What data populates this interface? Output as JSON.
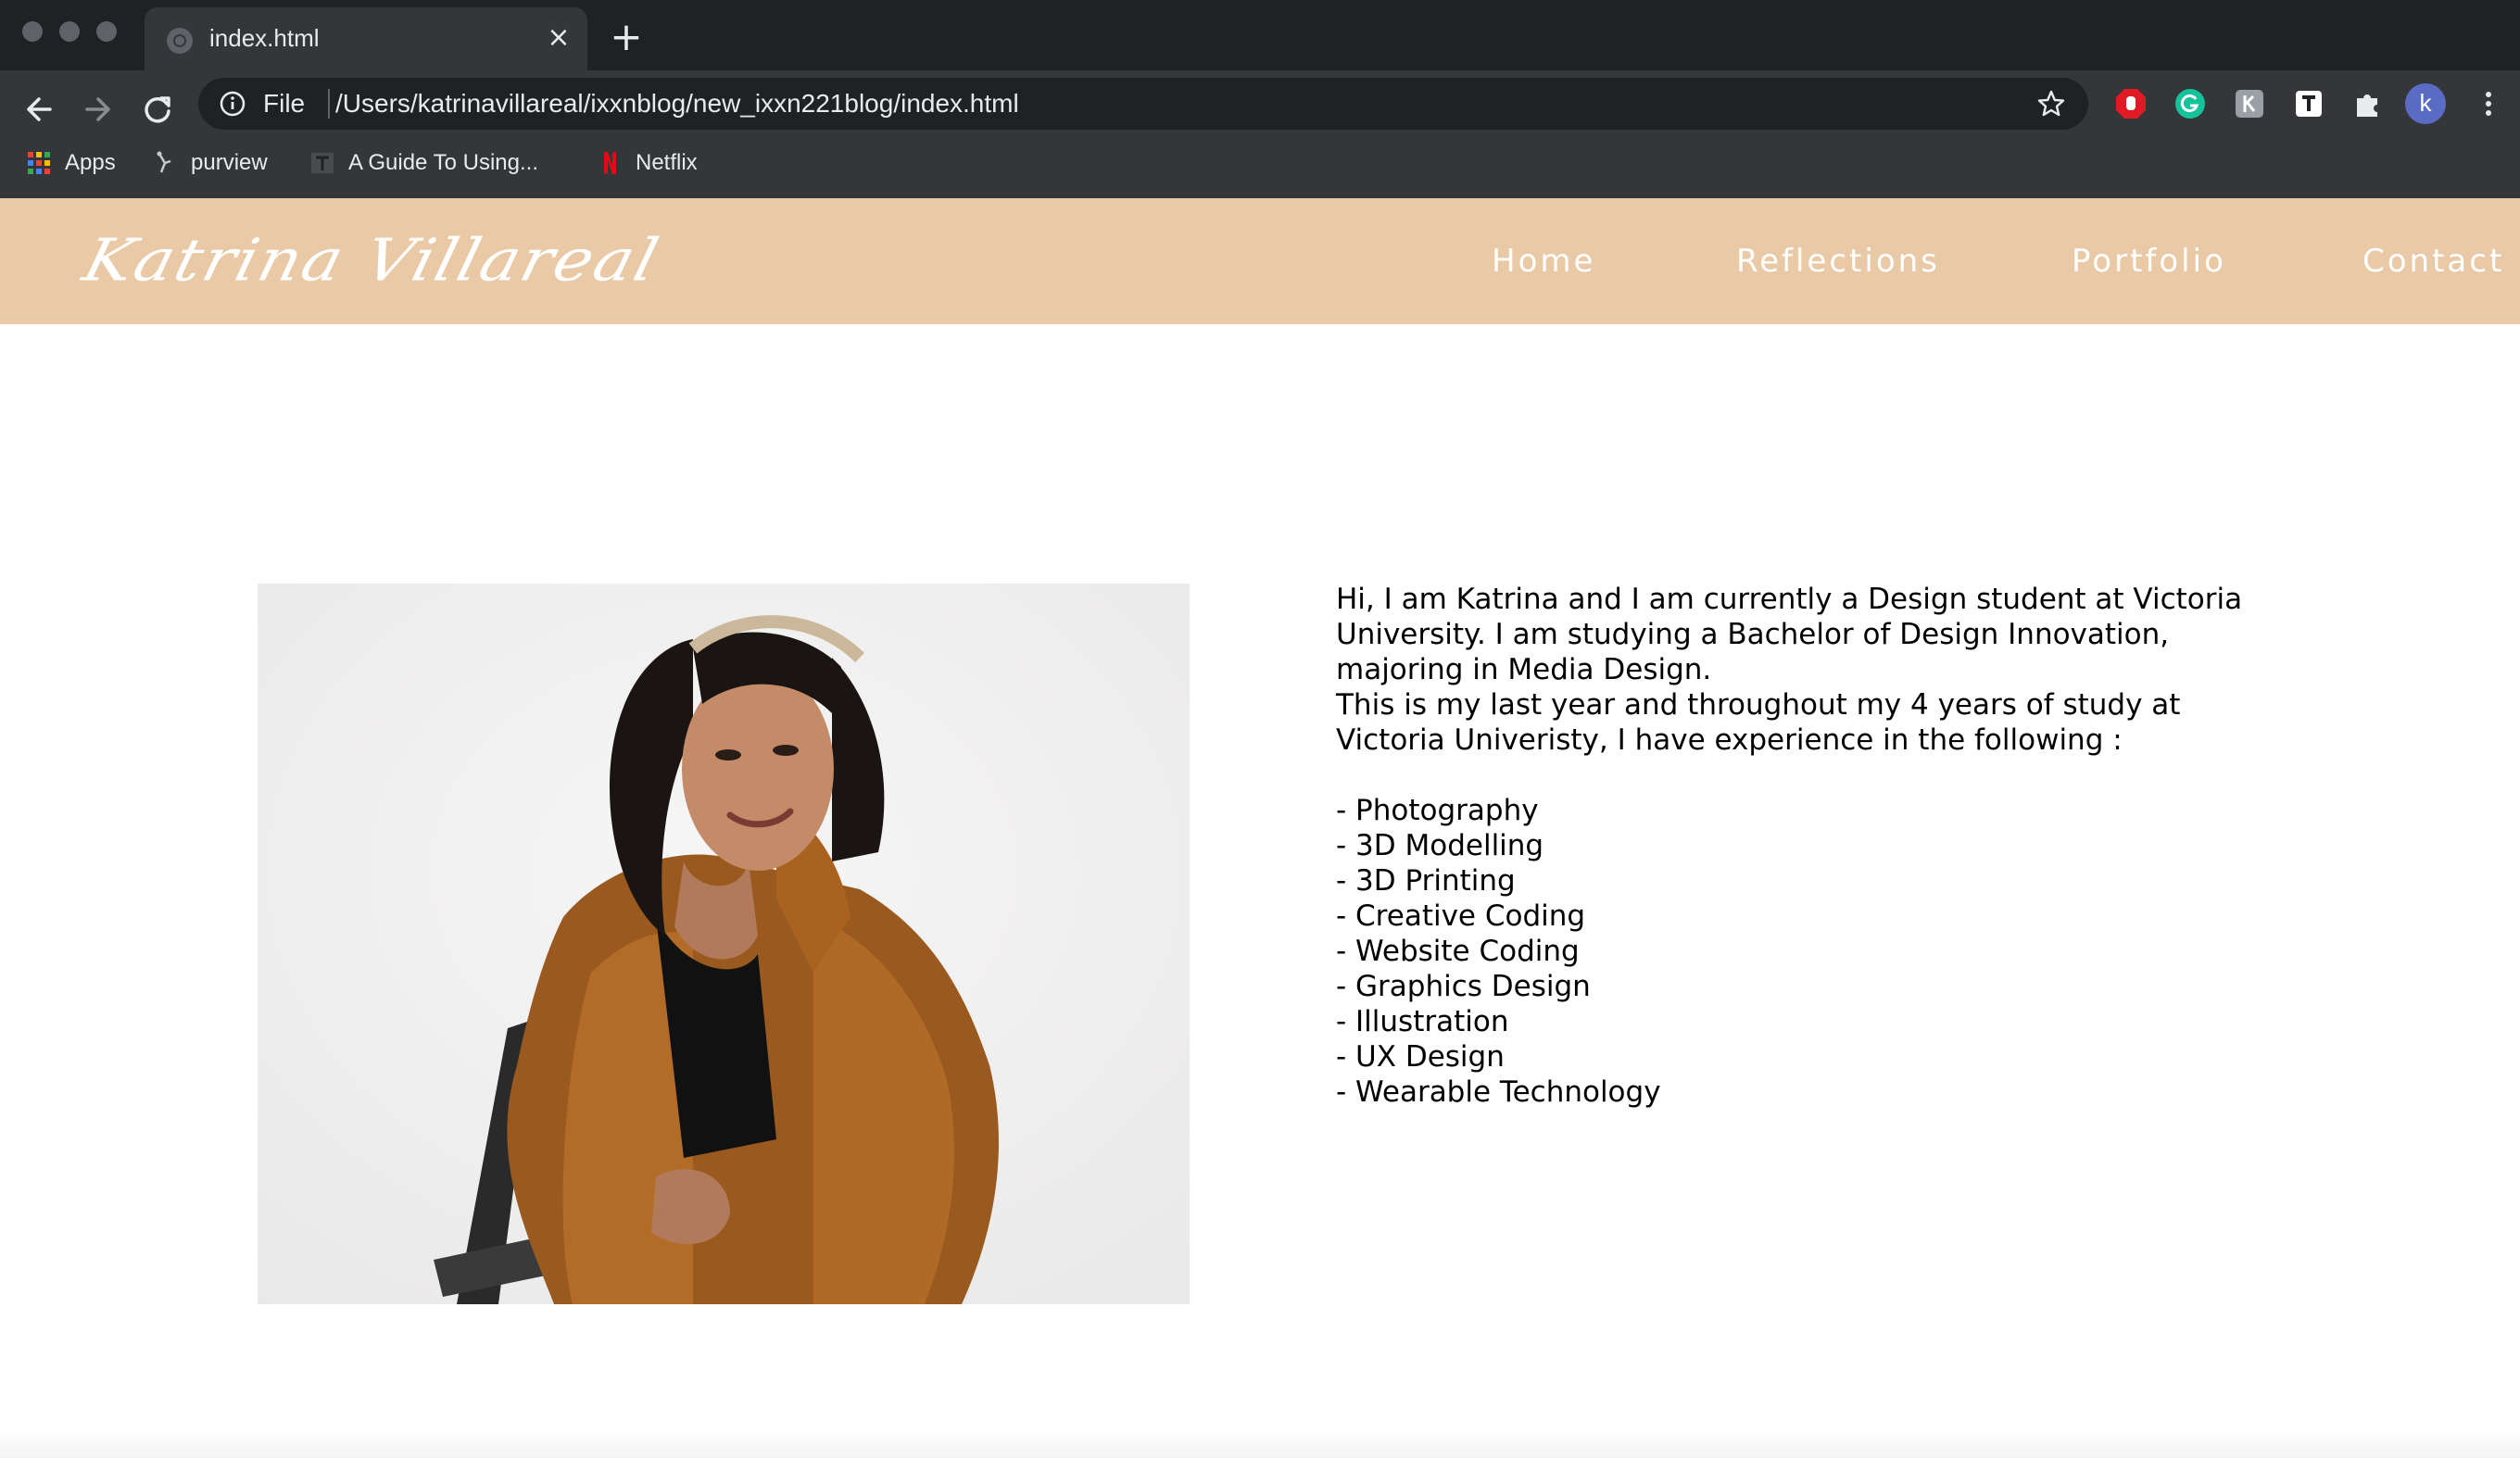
{
  "browser": {
    "tab_title": "index.html",
    "tab_close": "×",
    "new_tab": "+",
    "scheme_label": "File",
    "url": "/Users/katrinavillareal/ixxnblog/new_ixxn221blog/index.html",
    "profile_initial": "k",
    "bookmarks": [
      {
        "label": "Apps",
        "icon": "apps-grid-icon"
      },
      {
        "label": "purview",
        "icon": "purview-icon"
      },
      {
        "label": "A Guide To Using...",
        "icon": "guide-icon"
      },
      {
        "label": "Netflix",
        "icon": "netflix-icon"
      }
    ],
    "colors": {
      "frame": "#202124",
      "toolbar": "#35363a",
      "text": "#e8eaed"
    }
  },
  "site": {
    "logo_text": "Katrina Villareal",
    "nav": [
      "Home",
      "Reflections",
      "Portfolio",
      "Contact"
    ],
    "header_color": "#e9c9a6",
    "bio_intro": "Hi, I am Katrina and I am currently a Design student at Victoria University. I am studying a Bachelor of Design Innovation, majoring in Media Design.",
    "bio_experience": "This is my last year and throughout my 4 years of study at Victoria Univeristy, I have experience in the following :",
    "skills": [
      "- Photography",
      "- 3D Modelling",
      "- 3D Printing",
      "- Creative Coding",
      "- Website Coding",
      "- Graphics Design",
      "- Illustration",
      "- UX Design",
      "- Wearable Technology"
    ]
  }
}
